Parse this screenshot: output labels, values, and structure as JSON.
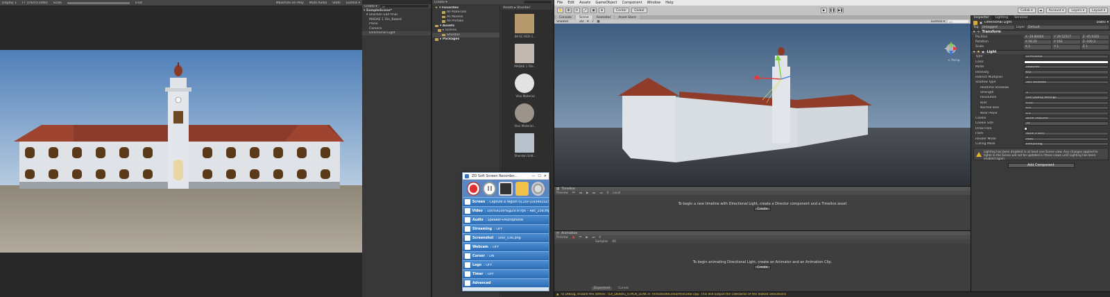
{
  "game": {
    "toolbar": {
      "display": "Display 1",
      "resolution": "FT (1920×1080)",
      "scale_label": "Scale",
      "scale_value": "0.64",
      "maximize": "Maximize On Play",
      "mute": "Mute Audio",
      "stats": "Stats",
      "gizmos": "Gizmos ▾"
    }
  },
  "hierarchy": {
    "create": "Create ▾",
    "search": "All",
    "items": [
      {
        "label": "▾ SampleScene*",
        "bold": true
      },
      {
        "label": "▾ Shardari Edit final"
      },
      {
        "label": "MADAE 1 File_Baked"
      },
      {
        "label": "Plane"
      },
      {
        "label": "Camera"
      },
      {
        "label": "Directional Light",
        "selected": true
      }
    ]
  },
  "project": {
    "create": "Create ▾",
    "tree": [
      {
        "label": "▾ Favorites",
        "hdr": true,
        "star": true
      },
      {
        "label": "All Materials"
      },
      {
        "label": "All Models"
      },
      {
        "label": "All Prefabs"
      },
      {
        "label": "▾ Assets",
        "hdr": true
      },
      {
        "label": "▸ Scenes"
      },
      {
        "label": "Shardari",
        "selected": true
      },
      {
        "label": "▸ Packages",
        "hdr": true
      }
    ],
    "breadcrumb": "Assets ▸ Shardari",
    "assets": [
      {
        "label": "6K-SC-RED-1...",
        "color": "#b69a6e"
      },
      {
        "label": "MADAE 1 File...",
        "color": "#c2b8b0"
      },
      {
        "label": "Vlex Material",
        "color": "#e2e2e2"
      },
      {
        "label": "Vlex Material...",
        "color": "#9c948a"
      },
      {
        "label": "Shardari Edit...",
        "color": "#b8c2cc"
      }
    ]
  },
  "recorder": {
    "title": "ZD Soft Screen Recorder...",
    "rows": [
      {
        "key": "Screen",
        "value": ": Capture a region (0,20)-(1934x1025)"
      },
      {
        "key": "Video",
        "value": ": 100%x100%@29.97fps – Rec_258.mp4"
      },
      {
        "key": "Audio",
        "value": ": Speaker+Microphone"
      },
      {
        "key": "Streaming",
        "value": ": OFF"
      },
      {
        "key": "Screenshot",
        "value": ": Shot_036.png"
      },
      {
        "key": "Webcam",
        "value": ": OFF"
      },
      {
        "key": "Cursor",
        "value": ": ON"
      },
      {
        "key": "Logo",
        "value": ": OFF"
      },
      {
        "key": "Timer",
        "value": ": OFF"
      },
      {
        "key": "Advanced",
        "value": ""
      }
    ]
  },
  "menu": [
    "File",
    "Edit",
    "Assets",
    "GameObject",
    "Component",
    "Window",
    "Help"
  ],
  "toolbar": {
    "center": "Center",
    "global": "Global",
    "collab": "Collab ▾",
    "account": "Account ▾",
    "layers": "Layers ▾",
    "layout": "Layout ▾"
  },
  "scene": {
    "tabs": [
      "Console",
      "Scene",
      "Animator",
      "Asset Store"
    ],
    "shading": "Shaded",
    "mode2d": "2D",
    "gizmos": "Gizmos ▾",
    "search": "All",
    "persp": "< Persp"
  },
  "timeline": {
    "tab": "Timeline",
    "preview": "Preview",
    "frame": "0",
    "local": "Local",
    "message": "To begin a new timeline with Directional Light, create a Director component and a Timeline asset",
    "button": "Create"
  },
  "animation": {
    "tab": "Animation",
    "preview": "Preview",
    "frame": "0",
    "samples": "Samples",
    "samples_value": "60",
    "message": "To begin animating Directional Light, create an Animator and an Animation Clip.",
    "button": "Create",
    "dopesheet": "Dopesheet",
    "curves": "Curves"
  },
  "status": "To Debug, enable the define: TLA_DEBUG_STACK_LEAK in ThreadsafeLinearAllocator.cpp. This will output the callstacks of the leaked allocations",
  "inspector": {
    "tabs": [
      "Inspector",
      "Lighting",
      "Services"
    ],
    "object_name": "Directional Light",
    "static": "Static ▾",
    "tag_label": "Tag",
    "tag": "Untagged",
    "layer_label": "Layer",
    "layer": "Default",
    "transform": {
      "title": "Transform",
      "position_label": "Position",
      "position": [
        "X -29.80464",
        "Y 29.52517",
        "Z -45.6325"
      ],
      "rotation_label": "Rotation",
      "rotation": [
        "X 56.25",
        "Y 162",
        "Z -100.3"
      ],
      "scale_label": "Scale",
      "scale": [
        "X 1",
        "Y 1",
        "Z 1"
      ]
    },
    "light": {
      "title": "Light",
      "props": [
        {
          "label": "Type",
          "value": "Directional"
        },
        {
          "label": "Color",
          "value": "",
          "white": true
        },
        {
          "label": "Mode",
          "value": "Realtime"
        },
        {
          "label": "Intensity",
          "value": "0.5"
        },
        {
          "label": "Indirect Multiplier",
          "value": "1"
        },
        {
          "label": "Shadow Type",
          "value": "Soft Shadows"
        },
        {
          "label": "Realtime Shadows",
          "value": null,
          "sub": true
        },
        {
          "label": "Strength",
          "value": "1",
          "sub": true
        },
        {
          "label": "Resolution",
          "value": "Use Quality Settings",
          "sub": true
        },
        {
          "label": "Bias",
          "value": "0.05",
          "sub": true
        },
        {
          "label": "Normal Bias",
          "value": "0.4",
          "sub": true
        },
        {
          "label": "Near Plane",
          "value": "0.2",
          "sub": true
        },
        {
          "label": "Cookie",
          "value": "None (Texture)"
        },
        {
          "label": "Cookie Size",
          "value": "10"
        },
        {
          "label": "Draw Halo",
          "value": ""
        },
        {
          "label": "Flare",
          "value": "None (Flare)"
        },
        {
          "label": "Render Mode",
          "value": "Auto"
        },
        {
          "label": "Culling Mask",
          "value": "Everything"
        }
      ]
    },
    "warning": "Lighting has been disabled in at least one Scene view. Any changes applied to lights in the Scene will not be updated in these views until Lighting has been enabled again.",
    "add_component": "Add Component"
  }
}
